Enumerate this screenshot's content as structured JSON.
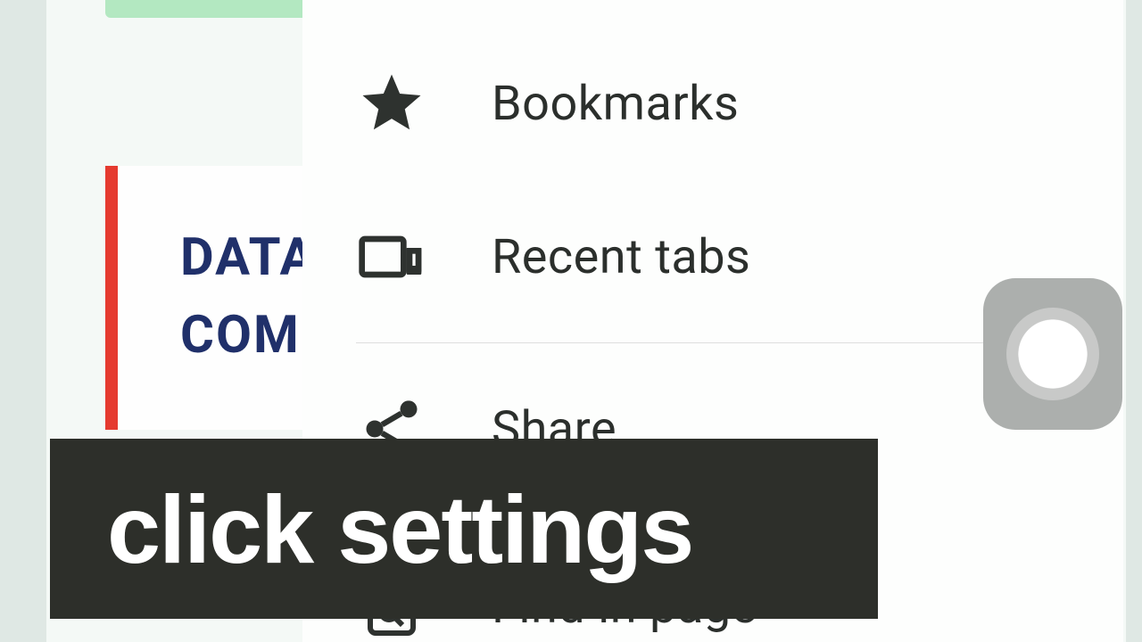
{
  "background": {
    "card_line1": "DATA",
    "card_line2": "COM"
  },
  "menu": {
    "bookmarks": "Bookmarks",
    "recent_tabs": "Recent tabs",
    "share": "Share",
    "find_in_page": "Find in page"
  },
  "caption": "click settings"
}
